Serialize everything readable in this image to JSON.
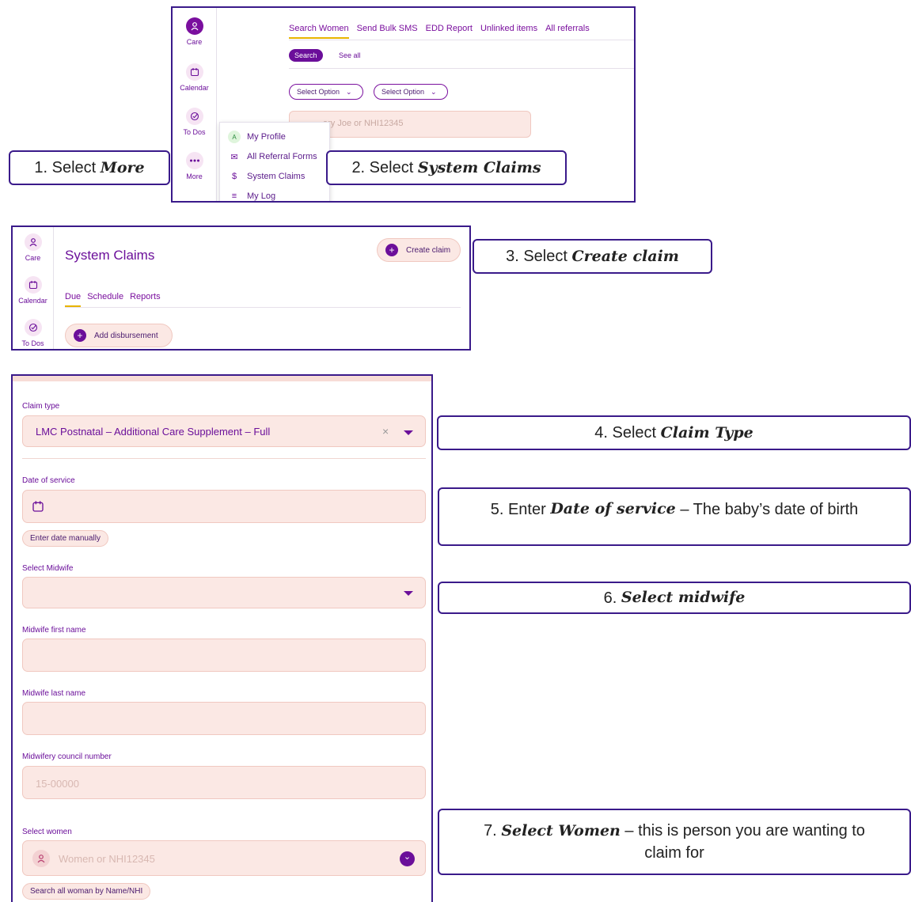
{
  "panel1": {
    "sidebar": [
      {
        "label": "Care",
        "icon": "person-icon"
      },
      {
        "label": "Calendar",
        "icon": "calendar-icon"
      },
      {
        "label": "To Dos",
        "icon": "check-circle-icon"
      },
      {
        "label": "More",
        "icon": "more-dots-icon"
      }
    ],
    "tabs": [
      "Search Women",
      "Send Bulk SMS",
      "EDD Report",
      "Unlinked items",
      "All referrals"
    ],
    "search_button": "Search",
    "see_all": "See all",
    "select1": "Select Option",
    "select2": "Select Option",
    "search_placeholder": "ary Joe or NHI12345",
    "menu": [
      {
        "label": "My Profile",
        "icon": "A"
      },
      {
        "label": "All Referral Forms",
        "icon": "forms-icon"
      },
      {
        "label": "System Claims",
        "icon": "$"
      },
      {
        "label": "My Log",
        "icon": "list-icon"
      }
    ]
  },
  "callouts": {
    "c1_prefix": "1. Select ",
    "c1_em": "More",
    "c2_prefix": "2. Select ",
    "c2_em": "System Claims",
    "c3_prefix": "3. Select ",
    "c3_em": "Create claim",
    "c4_prefix": "4. Select ",
    "c4_em": "Claim Type",
    "c5_prefix": "5. Enter ",
    "c5_em": "Date of service",
    "c5_suffix": " – The baby’s date of birth",
    "c6_prefix": "6. ",
    "c6_em": "Select midwife",
    "c7_prefix": "7. ",
    "c7_em": "Select Women",
    "c7_suffix_line1": " – this is person you are wanting to",
    "c7_line2": "claim for"
  },
  "panel2": {
    "sidebar": [
      {
        "label": "Care",
        "icon": "person-icon"
      },
      {
        "label": "Calendar",
        "icon": "calendar-icon"
      },
      {
        "label": "To Dos",
        "icon": "check-circle-icon"
      }
    ],
    "title": "System Claims",
    "create_claim": "Create claim",
    "tabs": [
      "Due",
      "Schedule",
      "Reports"
    ],
    "add_disbursement": "Add disbursement"
  },
  "form": {
    "claim_type_label": "Claim type",
    "claim_type_value": "LMC Postnatal – Additional Care Supplement – Full",
    "date_label": "Date of service",
    "enter_date_manually": "Enter date manually",
    "midwife_label": "Select Midwife",
    "first_name_label": "Midwife first name",
    "last_name_label": "Midwife last name",
    "council_label": "Midwifery council number",
    "council_placeholder": "15-00000",
    "women_label": "Select women",
    "women_placeholder": "Women or NHI12345",
    "search_all": "Search all woman by Name/NHI"
  },
  "colors": {
    "accent": "#6b0f9a",
    "field_bg": "#fbe8e4",
    "outline": "#3a1a8a",
    "tab_underline": "#e8b400"
  }
}
